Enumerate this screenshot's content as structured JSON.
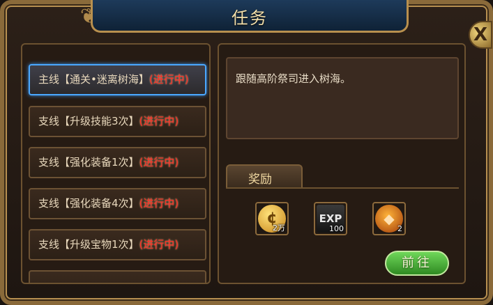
{
  "window": {
    "title": "任务",
    "close_label": "X"
  },
  "quests": [
    {
      "text": "主线【通关•迷离树海】",
      "status": "(进行中)",
      "selected": true
    },
    {
      "text": "支线【升级技能3次】",
      "status": "(进行中)",
      "selected": false
    },
    {
      "text": "支线【强化装备1次】",
      "status": "(进行中)",
      "selected": false
    },
    {
      "text": "支线【强化装备4次】",
      "status": "(进行中)",
      "selected": false
    },
    {
      "text": "支线【升级宝物1次】",
      "status": "(进行中)",
      "selected": false
    }
  ],
  "detail": {
    "description": "跟随高阶祭司进入树海。",
    "reward_tab_label": "奖励",
    "rewards": [
      {
        "icon": "gold-coin-icon",
        "glyph": "¢",
        "count": "2万"
      },
      {
        "icon": "exp-icon",
        "glyph": "EXP",
        "count": "100"
      },
      {
        "icon": "orange-gem-icon",
        "glyph": "◆",
        "count": "2"
      }
    ],
    "go_button_label": "前往"
  }
}
